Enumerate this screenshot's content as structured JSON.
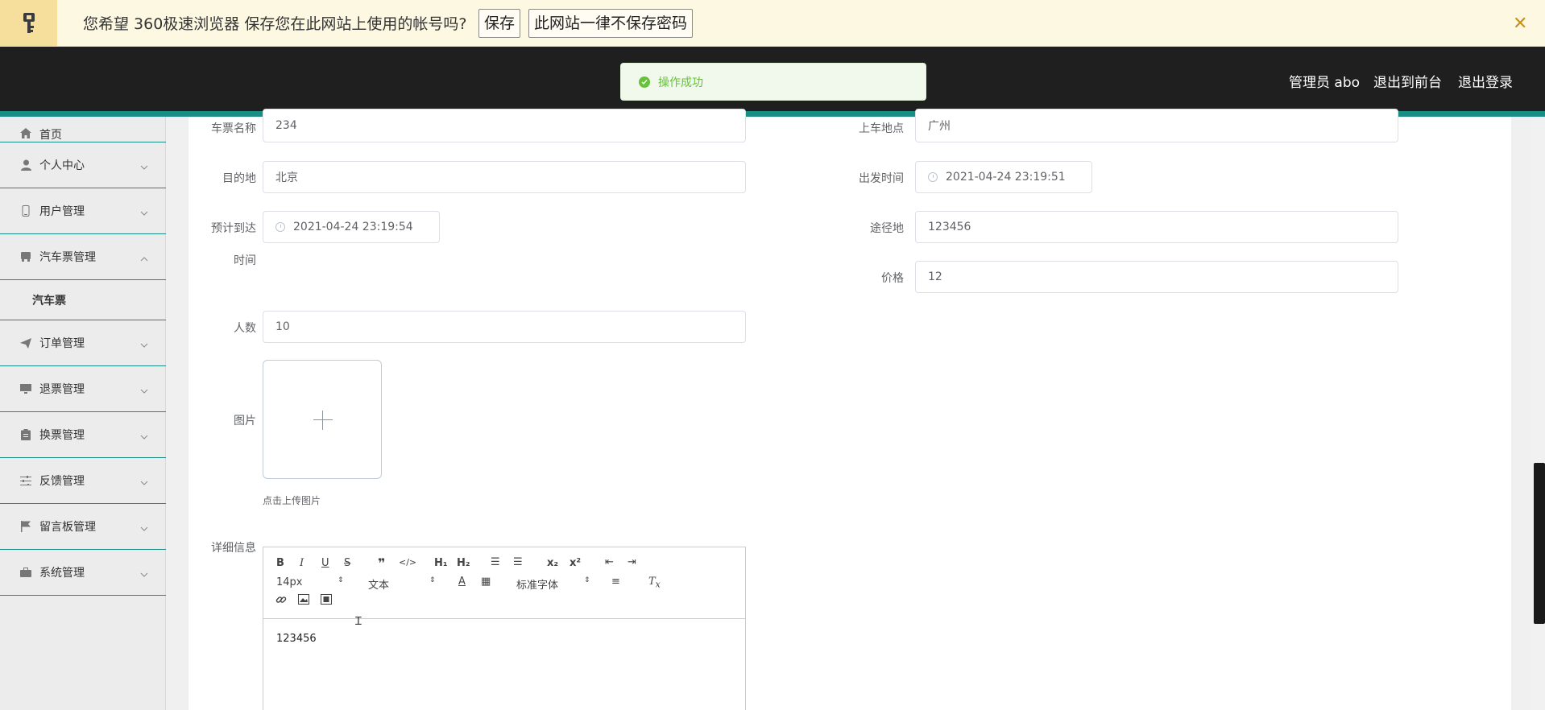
{
  "password_bar": {
    "message": "您希望 360极速浏览器 保存您在此网站上使用的帐号吗?",
    "save_label": "保存",
    "never_label": "此网站一律不保存密码",
    "close_glyph": "✕"
  },
  "header": {
    "toast": "操作成功",
    "admin": "管理员 abo",
    "to_front": "退出到前台",
    "logout": "退出登录"
  },
  "sidebar": {
    "items": [
      {
        "label": "首页"
      },
      {
        "label": "个人中心"
      },
      {
        "label": "用户管理"
      },
      {
        "label": "汽车票管理"
      },
      {
        "label": "汽车票"
      },
      {
        "label": "订单管理"
      },
      {
        "label": "退票管理"
      },
      {
        "label": "换票管理"
      },
      {
        "label": "反馈管理"
      },
      {
        "label": "留言板管理"
      },
      {
        "label": "系统管理"
      }
    ]
  },
  "form": {
    "ticket_name_label": "车票名称",
    "ticket_name_value": "234",
    "boarding_label": "上车地点",
    "boarding_value": "广州",
    "destination_label": "目的地",
    "destination_value": "北京",
    "departure_label": "出发时间",
    "departure_value": "2021-04-24 23:19:51",
    "arrival_label_1": "预计到达",
    "arrival_label_2": "时间",
    "arrival_value": "2021-04-24 23:19:54",
    "route_label": "途径地",
    "route_value": "123456",
    "price_label": "价格",
    "price_value": "12",
    "people_label": "人数",
    "people_value": "10",
    "image_label": "图片",
    "upload_tip": "点击上传图片",
    "detail_label": "详细信息"
  },
  "editor": {
    "font_size": "14px",
    "header_select": "文本",
    "font_family": "标准字体",
    "content": "123456"
  },
  "colors": {
    "accent": "#1a8d86",
    "success": "#67c23a",
    "header_bg": "#1f1f1f"
  }
}
